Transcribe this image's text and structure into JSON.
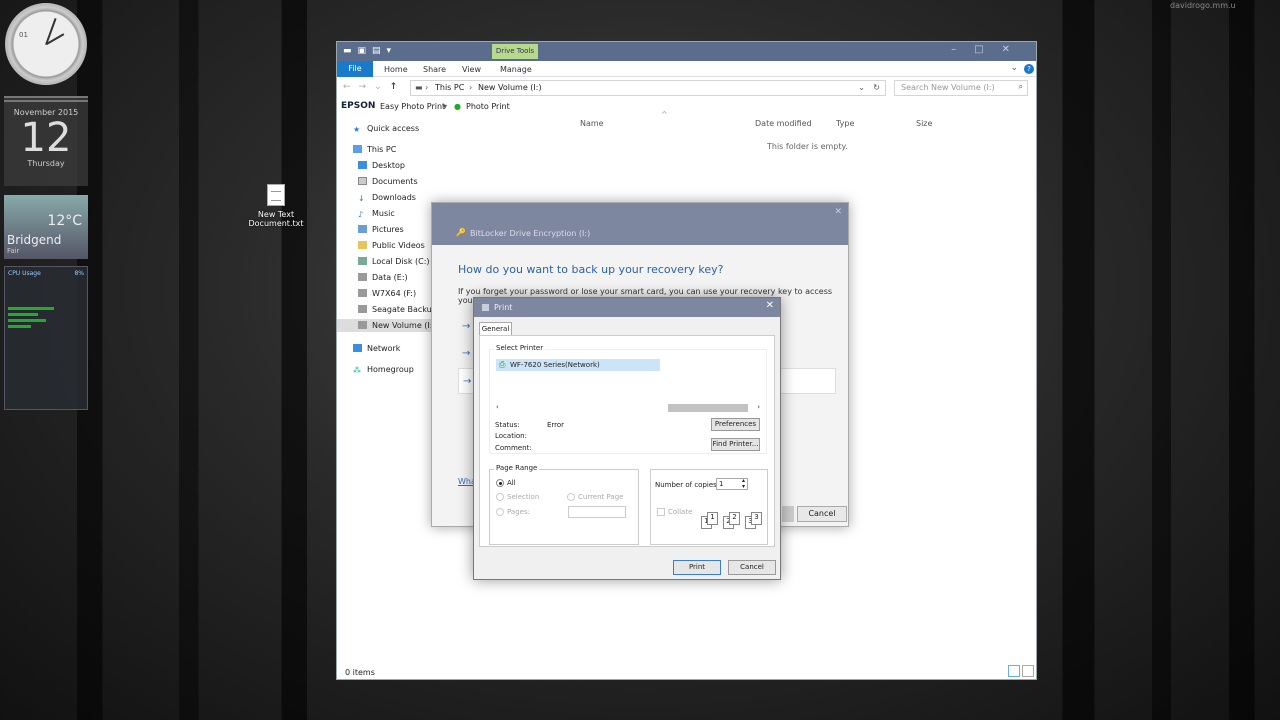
{
  "watermark": "davidrogo.mm.u",
  "gadgets": {
    "clock_label": "01",
    "cal_month": "November 2015",
    "cal_day": "12",
    "cal_weekday": "Thursday",
    "weather_temp": "12°C",
    "weather_city": "Bridgend",
    "weather_cond": "Fair",
    "cpu_title": "CPU Usage",
    "cpu_pct": "8%"
  },
  "desktop_icon": {
    "label": "New Text Document.txt"
  },
  "explorer": {
    "context_tab": "Drive Tools",
    "ribbon_tabs": [
      "File",
      "Home",
      "Share",
      "View",
      "Manage"
    ],
    "address": [
      "This PC",
      "New Volume (I:)"
    ],
    "search_placeholder": "Search New Volume (I:)",
    "epson": {
      "logo": "EPSON",
      "easy": "Easy Photo Print",
      "photo": "Photo Print"
    },
    "nav_items": [
      "Quick access",
      "This PC",
      "Desktop",
      "Documents",
      "Downloads",
      "Music",
      "Pictures",
      "Public Videos",
      "Local Disk (C:)",
      "Data (E:)",
      "W7X64 (F:)",
      "Seagate Backup P",
      "New Volume (I:)",
      "Network",
      "Homegroup"
    ],
    "columns": [
      "Name",
      "Date modified",
      "Type",
      "Size"
    ],
    "empty_text": "This folder is empty.",
    "status": "0 items"
  },
  "bitlocker": {
    "title": "BitLocker Drive Encryption (I:)",
    "question": "How do you want to back up your recovery key?",
    "desc": "If you forget your password or lose your smart card, you can use your recovery key to access your drive.",
    "what_link": "What",
    "cancel": "Cancel"
  },
  "print": {
    "title": "Print",
    "tab": "General",
    "select_printer": "Select Printer",
    "printer": "WF-7620 Series(Network)",
    "status_label": "Status:",
    "status_value": "Error",
    "location_label": "Location:",
    "comment_label": "Comment:",
    "preferences": "Preferences",
    "find_printer": "Find Printer...",
    "page_range": "Page Range",
    "all": "All",
    "selection": "Selection",
    "current_page": "Current Page",
    "pages": "Pages:",
    "copies_label": "Number of copies:",
    "copies_value": "1",
    "collate": "Collate",
    "print_btn": "Print",
    "cancel_btn": "Cancel"
  }
}
